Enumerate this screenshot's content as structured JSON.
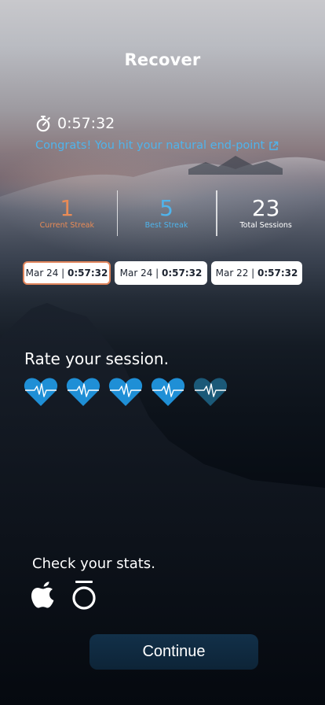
{
  "header": {
    "title": "Recover"
  },
  "session": {
    "duration": "0:57:32",
    "message": "Congrats! You hit your natural end-point"
  },
  "stats": [
    {
      "value": "1",
      "label": "Current Streak",
      "color": "#e98b56"
    },
    {
      "value": "5",
      "label": "Best Streak",
      "color": "#4fb4ec"
    },
    {
      "value": "23",
      "label": "Total Sessions",
      "color": "#ffffff"
    }
  ],
  "history": [
    {
      "date": "Mar 24",
      "separator": " | ",
      "duration": "0:57:32",
      "selected": true
    },
    {
      "date": "Mar 24",
      "separator": " | ",
      "duration": "0:57:32",
      "selected": false
    },
    {
      "date": "Mar 22",
      "separator": " | ",
      "duration": "0:57:32",
      "selected": false
    }
  ],
  "rating": {
    "title": "Rate your session.",
    "value": 4,
    "max": 5,
    "active_color": "#1f8fd6",
    "inactive_color": "#1b5978"
  },
  "stats_links": {
    "title": "Check your stats.",
    "apps": [
      "apple-health-icon",
      "oura-ring-icon"
    ]
  },
  "actions": {
    "continue_label": "Continue"
  }
}
